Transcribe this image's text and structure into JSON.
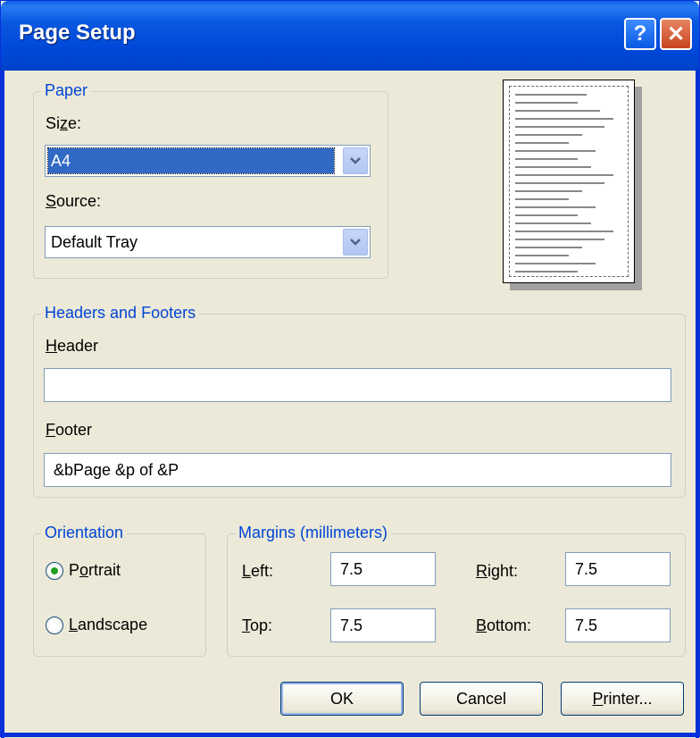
{
  "window": {
    "title": "Page Setup",
    "help_glyph": "?",
    "close_glyph": "✕"
  },
  "paper": {
    "legend": "Paper",
    "size_label_pre": "Si",
    "size_label_key": "z",
    "size_label_post": "e:",
    "size_value": "A4",
    "source_label_key": "S",
    "source_label_post": "ource:",
    "source_value": "Default Tray"
  },
  "headers_footers": {
    "legend": "Headers and Footers",
    "header_label_key": "H",
    "header_label_post": "eader",
    "header_value": "",
    "footer_label_key": "F",
    "footer_label_post": "ooter",
    "footer_value": "&bPage &p of &P"
  },
  "orientation": {
    "legend": "Orientation",
    "portrait_pre": "P",
    "portrait_key": "o",
    "portrait_post": "rtrait",
    "landscape_key": "L",
    "landscape_post": "andscape",
    "selected": "Portrait"
  },
  "margins": {
    "legend": "Margins (millimeters)",
    "left_key": "L",
    "left_post": "eft:",
    "left_value": "7.5",
    "right_key": "R",
    "right_post": "ight:",
    "right_value": "7.5",
    "top_key": "T",
    "top_post": "op:",
    "top_value": "7.5",
    "bottom_key": "B",
    "bottom_post": "ottom:",
    "bottom_value": "7.5"
  },
  "buttons": {
    "ok": "OK",
    "cancel": "Cancel",
    "printer_key": "P",
    "printer_post": "rinter..."
  },
  "colors": {
    "title_bar": "#0a58e0",
    "legend_text": "#0046d5",
    "selection": "#316ac5",
    "radio_dot": "#21a121"
  }
}
